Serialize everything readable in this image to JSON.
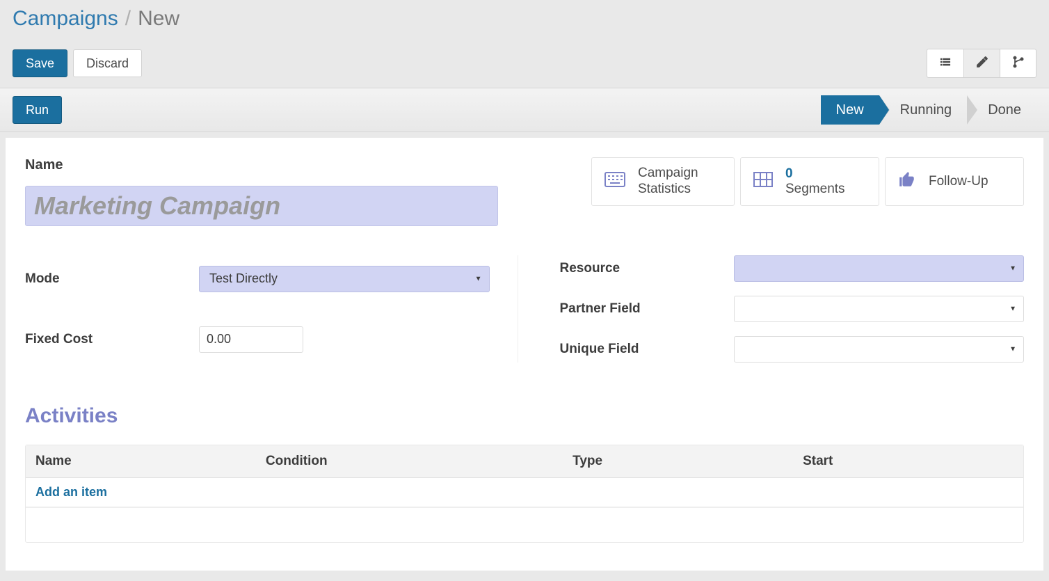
{
  "breadcrumb": {
    "parent": "Campaigns",
    "current": "New"
  },
  "buttons": {
    "save": "Save",
    "discard": "Discard",
    "run": "Run"
  },
  "stages": {
    "new": "New",
    "running": "Running",
    "done": "Done"
  },
  "form": {
    "name_label": "Name",
    "name_placeholder": "Marketing Campaign",
    "name_value": "",
    "mode_label": "Mode",
    "mode_value": "Test Directly",
    "fixed_cost_label": "Fixed Cost",
    "fixed_cost_value": "0.00",
    "resource_label": "Resource",
    "resource_value": "",
    "partner_field_label": "Partner Field",
    "partner_field_value": "",
    "unique_field_label": "Unique Field",
    "unique_field_value": ""
  },
  "stats": {
    "campaign_stats_label": "Campaign Statistics",
    "segments_count": "0",
    "segments_label": "Segments",
    "followup_label": "Follow-Up"
  },
  "activities": {
    "title": "Activities",
    "columns": {
      "name": "Name",
      "condition": "Condition",
      "type": "Type",
      "start": "Start"
    },
    "add_item": "Add an item"
  }
}
